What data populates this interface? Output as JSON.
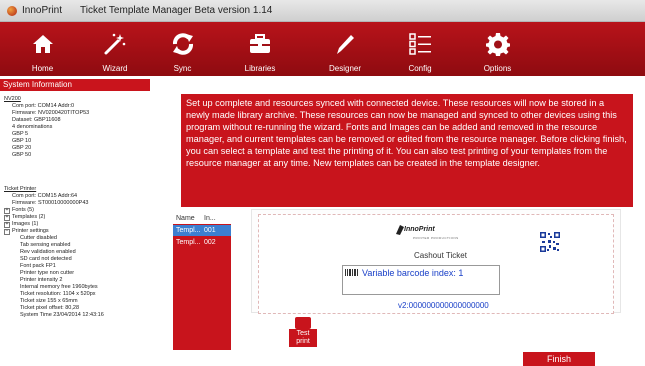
{
  "titlebar": {
    "app_name": "InnoPrint",
    "window_title": "Ticket Template Manager Beta version 1.14"
  },
  "toolbar": {
    "items": [
      {
        "label": "Home",
        "icon": "home-icon"
      },
      {
        "label": "Wizard",
        "icon": "wand-icon"
      },
      {
        "label": "Sync",
        "icon": "sync-icon"
      },
      {
        "label": "Libraries",
        "icon": "toolbox-icon"
      },
      {
        "label": "Designer",
        "icon": "pen-icon"
      },
      {
        "label": "Config",
        "icon": "checklist-icon"
      },
      {
        "label": "Options",
        "icon": "gear-icon"
      }
    ]
  },
  "system_info": {
    "title": "System Information",
    "device1": {
      "name": "NV200",
      "lines": [
        "Com port: COM14 Addr:0",
        "Firmware: NV0200420TITOP53",
        "Dataset: GBP11608",
        "4 denominations",
        "GBP 5",
        "GBP 10",
        "GBP 20",
        "GBP 50"
      ]
    },
    "device2": {
      "name": "Ticket Printer",
      "lines": [
        "Com port: COM15 Addr:64",
        "Firmware: ST00010000000P43"
      ]
    },
    "tree": {
      "fonts": "Fonts (5)",
      "templates": "Templates (2)",
      "images": "Images (1)",
      "printer_settings": "Printer settings",
      "settings": [
        "Cutter disabled",
        "Tab sensing enabled",
        "Rev validation enabled",
        "SD card not detected",
        "Font pack FP1",
        "Printer type non cutter",
        "Printer intensity 2",
        "Internal memory free 1960bytes",
        "Ticket resolution: 1104 x 520px",
        "Ticket size 155 x 65mm",
        "Ticket pixel offset: 80,28",
        "System Time 23/04/2014 12:43:16"
      ]
    }
  },
  "message": "Set up complete and resources synced with connected device. These resources will now be stored in a newly made library archive. These resources can now be managed and synced to other devices using this program without re-running the wizard. Fonts and Images can be added and removed in the resource manager, and current templates can be removed or edited from the resource manager. Before clicking finish, you can select a template and test the printing of it. You can also test printing of your templates from the resource manager at any time. New templates can be created in the template designer.",
  "template_list": {
    "headers": [
      "Name",
      "In..."
    ],
    "rows": [
      {
        "name": "Templ...",
        "index": "001"
      },
      {
        "name": "Templ...",
        "index": "002"
      }
    ]
  },
  "preview": {
    "logo": "InnoPrint",
    "logo_sub": "PRINTER PRODUCTIONS",
    "title": "Cashout Ticket",
    "barcode": "Variable barcode index: 1",
    "v2": "v2:000000000000000000"
  },
  "buttons": {
    "test_print": "Test print",
    "finish": "Finish"
  },
  "colors": {
    "accent": "#c8141c",
    "selected": "#3c7fd0",
    "text_blue": "#1a40c8"
  }
}
